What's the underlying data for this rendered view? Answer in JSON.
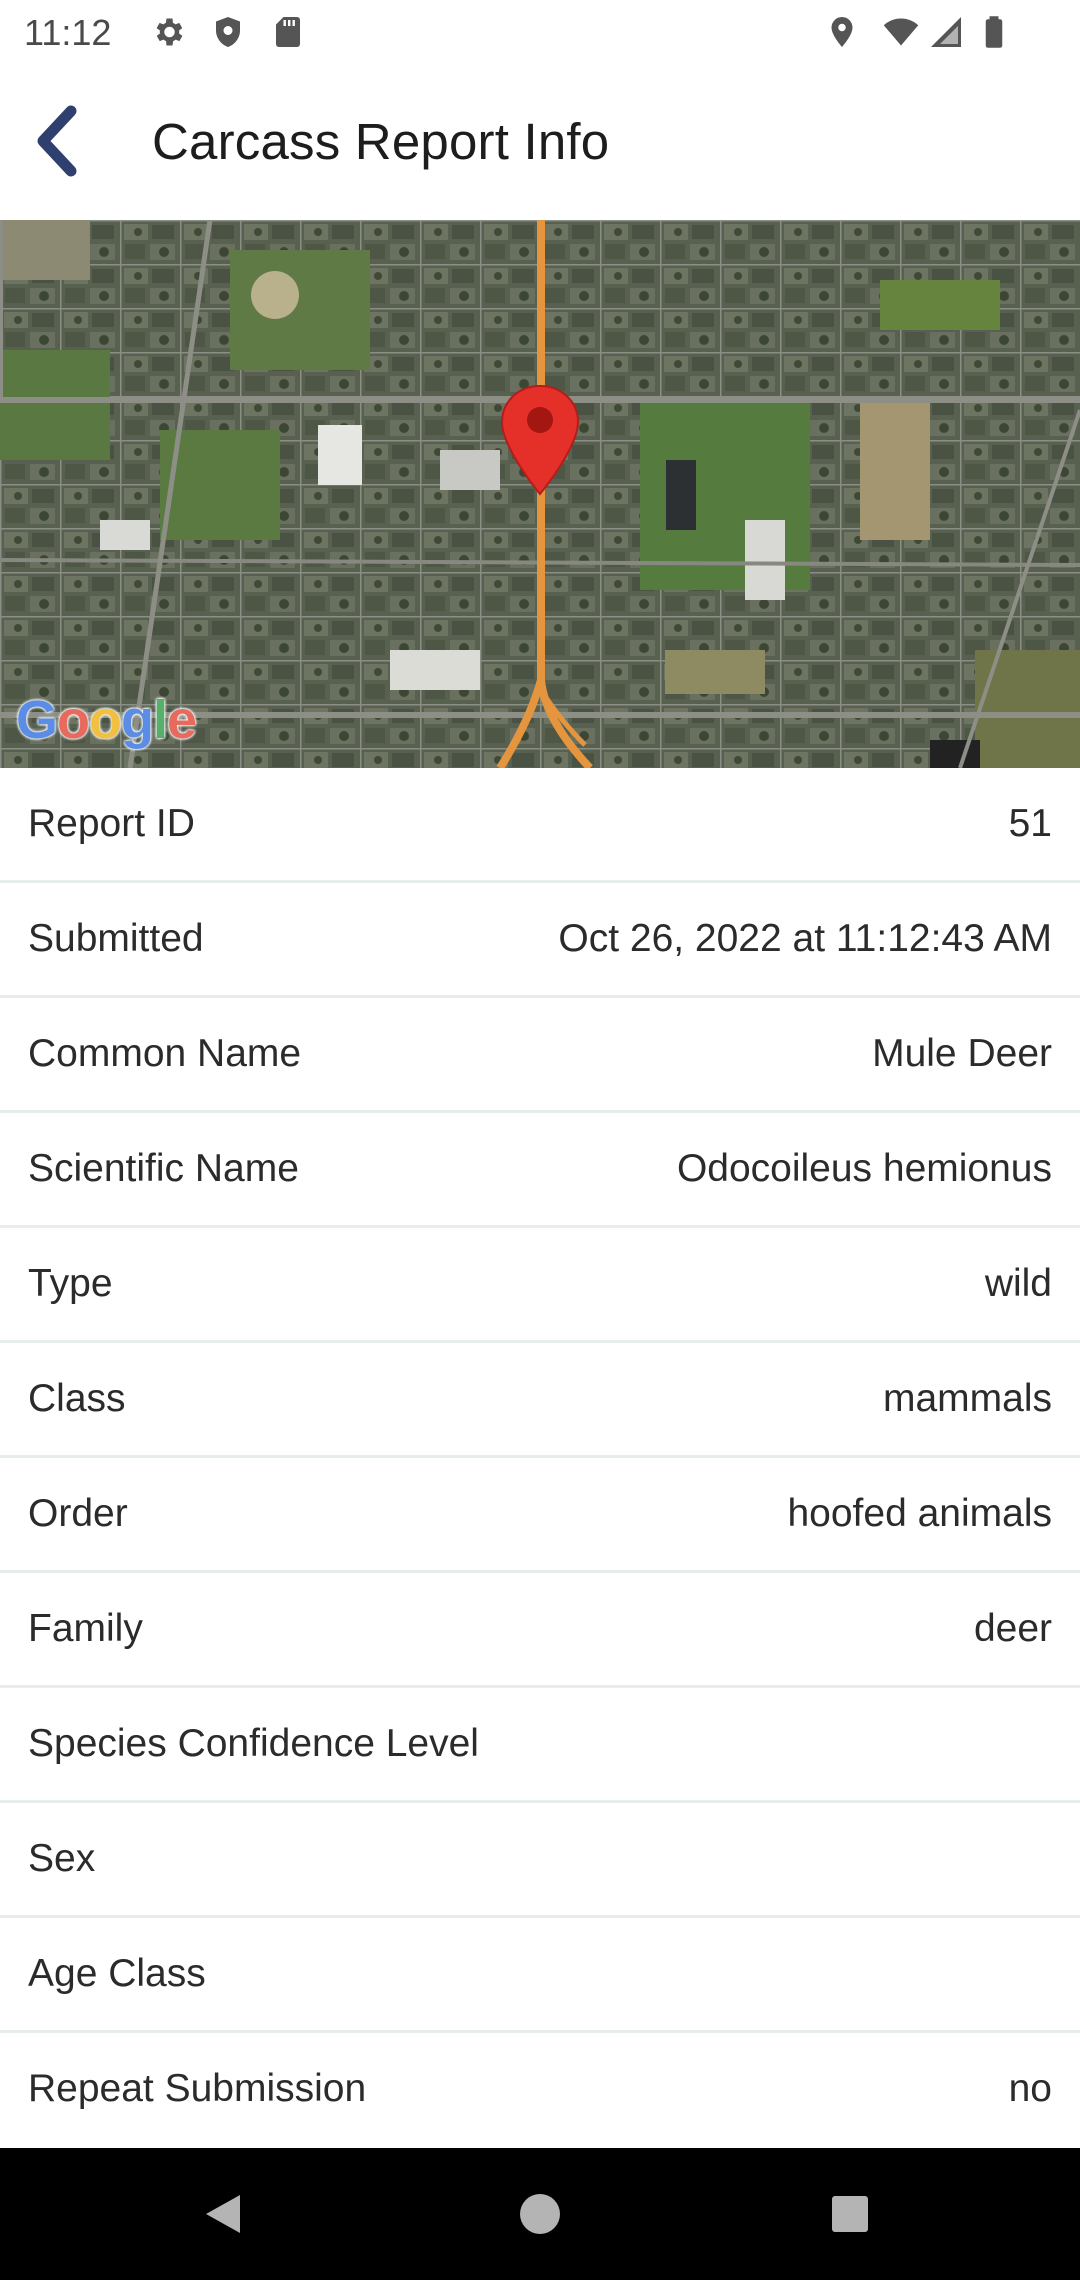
{
  "status_bar": {
    "time": "11:12",
    "left_icons": [
      "settings-icon",
      "shield-icon",
      "sd-card-icon"
    ],
    "right_icons": [
      "location-icon",
      "wifi-icon",
      "signal-icon",
      "battery-icon"
    ]
  },
  "app_bar": {
    "title": "Carcass Report Info",
    "back_icon": "chevron-left-icon",
    "accent_color": "#2f3f6e"
  },
  "map": {
    "attribution": "Google",
    "marker_color": "#e5302a"
  },
  "details": [
    {
      "label": "Report ID",
      "value": "51"
    },
    {
      "label": "Submitted",
      "value": "Oct 26, 2022 at 11:12:43 AM"
    },
    {
      "label": "Common Name",
      "value": "Mule Deer"
    },
    {
      "label": "Scientific Name",
      "value": "Odocoileus hemionus"
    },
    {
      "label": "Type",
      "value": "wild"
    },
    {
      "label": "Class",
      "value": "mammals"
    },
    {
      "label": "Order",
      "value": "hoofed animals"
    },
    {
      "label": "Family",
      "value": "deer"
    },
    {
      "label": "Species Confidence Level",
      "value": ""
    },
    {
      "label": "Sex",
      "value": ""
    },
    {
      "label": "Age Class",
      "value": ""
    },
    {
      "label": "Repeat Submission",
      "value": "no"
    }
  ],
  "nav_bar": {
    "icons": [
      "back-triangle-icon",
      "home-circle-icon",
      "recents-square-icon"
    ]
  }
}
